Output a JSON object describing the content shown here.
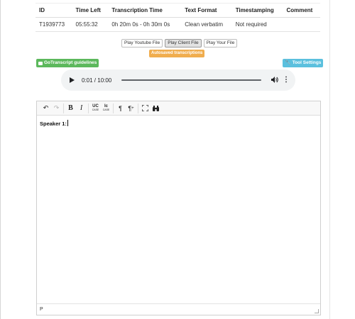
{
  "table": {
    "headers": [
      "ID",
      "Time Left",
      "Transcription Time",
      "Text Format",
      "Timestamping",
      "Comment"
    ],
    "row": [
      "T1939773",
      "05:55:32",
      "0h 20m 0s - 0h 30m 0s",
      "Clean verbatim",
      "Not required",
      ""
    ]
  },
  "player_buttons": {
    "youtube": "Play Youtube File",
    "client": "Play Client File",
    "yours": "Play Your File"
  },
  "autosave_label": "Autosaved transcriptions",
  "guidelines_label": "GoTranscript guidelines",
  "tool_settings_label": "Tool Settings",
  "audio": {
    "time": "0:01 / 10:00",
    "progress_fraction": 0.0017
  },
  "editor": {
    "speaker_label": "Speaker 1:",
    "status_path": "P"
  },
  "colors": {
    "autosave": "#f0ad4e",
    "guidelines": "#5cb85c",
    "tool_settings": "#5bc0de"
  }
}
